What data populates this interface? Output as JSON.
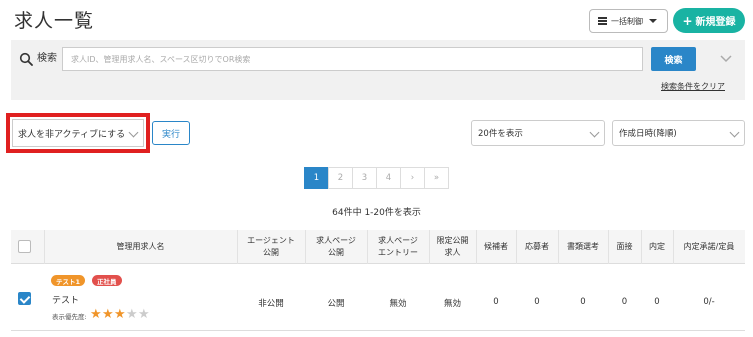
{
  "header": {
    "title": "求人一覧",
    "bulk_control_label": "一括制御",
    "new_button_label": "新規登録"
  },
  "search": {
    "label": "検索",
    "placeholder": "求人ID、管理用求人名、スペース区切りでOR検索",
    "button_label": "検索",
    "clear_link": "検索条件をクリア"
  },
  "controls": {
    "action_select_value": "求人を非アクティブにする",
    "run_button_label": "実行",
    "per_page_value": "20件を表示",
    "sort_value": "作成日時(降順)"
  },
  "pagination": {
    "pages": [
      "1",
      "2",
      "3",
      "4",
      "›",
      "»"
    ],
    "active_page": 1,
    "result_count": "64件中 1-20件を表示"
  },
  "table": {
    "headers": {
      "name": "管理用求人名",
      "agent_public_1": "エージェント",
      "agent_public_2": "公開",
      "job_page_public_1": "求人ページ",
      "job_page_public_2": "公開",
      "job_page_entry_1": "求人ページ",
      "job_page_entry_2": "エントリー",
      "limited_public_1": "限定公開",
      "limited_public_2": "求人",
      "candidates": "候補者",
      "applicants": "応募者",
      "document_screening": "書類選考",
      "interview": "面接",
      "offer": "内定",
      "offer_accept": "内定承諾/定員"
    },
    "rows": [
      {
        "checked": true,
        "badges": [
          {
            "label": "テスト1",
            "color": "#f0952a"
          },
          {
            "label": "正社員",
            "color": "#e2504c"
          }
        ],
        "name": "テスト",
        "priority_label": "表示優先度:",
        "priority_stars": 3,
        "priority_max": 5,
        "agent_public": "非公開",
        "job_page_public": "公開",
        "job_page_entry": "無効",
        "limited_public": "無効",
        "candidates": "0",
        "applicants": "0",
        "document_screening": "0",
        "interview": "0",
        "offer": "0",
        "offer_accept": "0/-"
      }
    ]
  },
  "colors": {
    "primary": "#2a86c8",
    "new_button": "#19b3a3",
    "highlight_border": "#e02020",
    "star_on": "#f0952a",
    "star_off": "#cccccc"
  }
}
